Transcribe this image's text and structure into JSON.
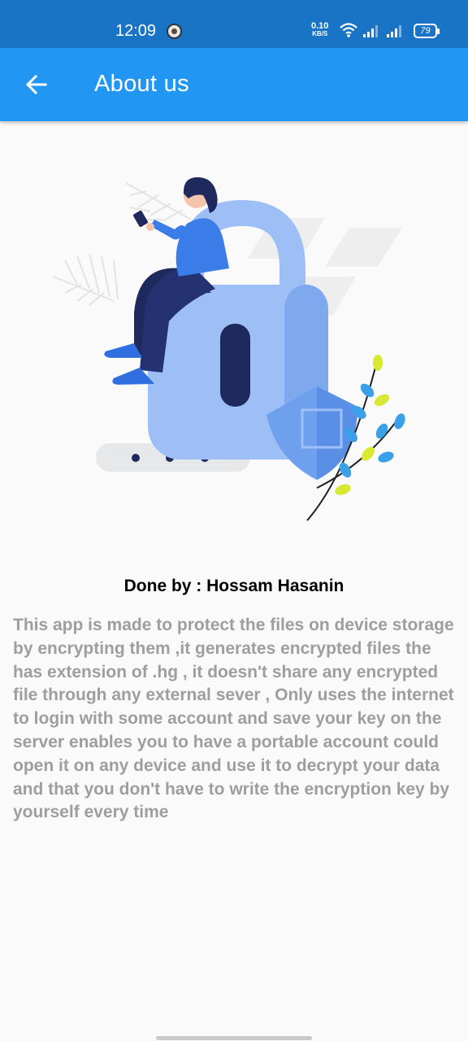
{
  "status_bar": {
    "time": "12:09",
    "net_speed_value": "0.10",
    "net_speed_unit": "KB/S",
    "battery": "79"
  },
  "app_bar": {
    "title": "About us",
    "back_icon": "arrow-left-icon"
  },
  "illustration": "woman-sitting-on-padlock-with-shield-illustration",
  "author": "Done by : Hossam Hasanin",
  "description": "This app is made to protect the files on device storage by encrypting them ,it generates encrypted files the has extension of .hg ,  it doesn't share any encrypted file through any external sever , Only uses the internet to login with some account and save your key on the server enables you to have a portable account could open it on any device and use it to decrypt your data and that you don't have to write the encryption key by yourself every time",
  "colors": {
    "status_bar": "#1a74c5",
    "app_bar": "#2196f3",
    "background": "#fafafa",
    "description_text": "#9e9e9e"
  }
}
